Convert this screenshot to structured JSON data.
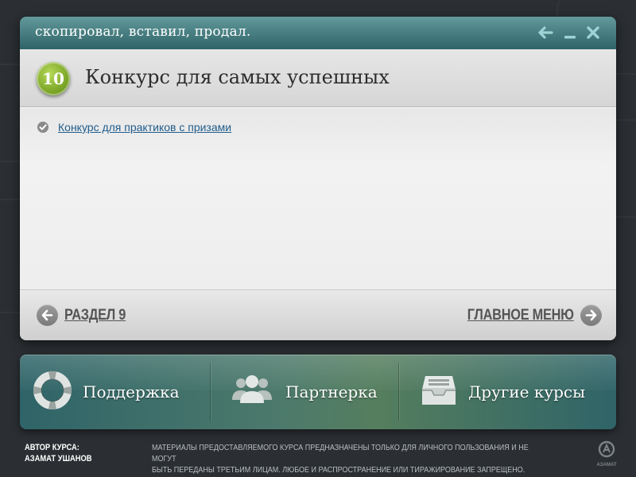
{
  "window": {
    "title": "скопировал, вставил, продал.",
    "controls": [
      "back-arrow-icon",
      "minimize-icon",
      "close-icon"
    ]
  },
  "lesson": {
    "number": "10",
    "title": "Конкурс для самых успешных",
    "items": [
      {
        "icon": "check-circle-icon",
        "label": "Конкурс для практиков с призами"
      }
    ]
  },
  "navigation": {
    "prev_label": "РАЗДЕЛ 9",
    "next_label": "ГЛАВНОЕ МЕНЮ"
  },
  "toolbar": {
    "buttons": [
      {
        "icon": "lifebuoy-icon",
        "label": "Поддержка"
      },
      {
        "icon": "users-icon",
        "label": "Партнерка"
      },
      {
        "icon": "inbox-tray-icon",
        "label": "Другие курсы"
      }
    ]
  },
  "footer": {
    "author_label": "АВТОР КУРСА:",
    "author_name": "АЗАМАТ УШАНОВ",
    "disclaimer_line1": "МАТЕРИАЛЫ ПРЕДОСТАВЛЯЕМОГО КУРСА ПРЕДНАЗНАЧЕНЫ ТОЛЬКО ДЛЯ ЛИЧНОГО ПОЛЬЗОВАНИЯ И НЕ МОГУТ",
    "disclaimer_line2": "БЫТЬ ПЕРЕДАНЫ ТРЕТЬИМ ЛИЦАМ. ЛЮБОЕ И РАСПРОСТРАНЕНИЕ ИЛИ ТИРАЖИРОВАНИЕ ЗАПРЕЩЕНО.",
    "logo_text": "АЗАМАТ"
  },
  "colors": {
    "background": "#2b2f33",
    "titlebar": "#3f7a7d",
    "badge": "#8cb832",
    "link": "#1f5c8c",
    "nav_text": "#555555"
  }
}
